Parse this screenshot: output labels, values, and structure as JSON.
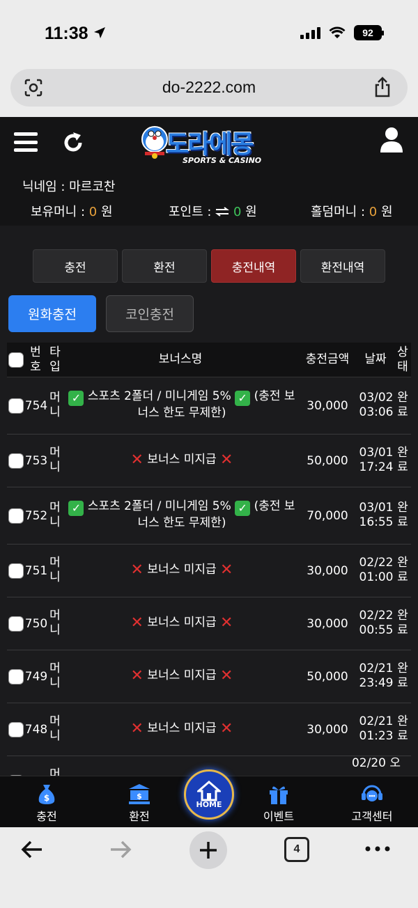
{
  "status_bar": {
    "time": "11:38",
    "battery": "92"
  },
  "browser": {
    "url": "do-2222.com",
    "tab_count": "4"
  },
  "site": {
    "logo_text": "도라에몽",
    "logo_sub": "SPORTS & CASINO",
    "nickname_label": "닉네임 : 마르코찬",
    "money_label": "보유머니 :",
    "money_value": "0",
    "money_unit": "원",
    "point_label": "포인트 :",
    "point_value": "0",
    "point_unit": "원",
    "holdem_label": "홀덤머니 :",
    "holdem_value": "0",
    "holdem_unit": "원"
  },
  "tabs": [
    {
      "label": "충전",
      "active": false
    },
    {
      "label": "환전",
      "active": false
    },
    {
      "label": "충전내역",
      "active": true
    },
    {
      "label": "환전내역",
      "active": false
    }
  ],
  "sub_tabs": {
    "won": "원화충전",
    "coin": "코인충전"
  },
  "table": {
    "headers": {
      "num": "번\n호",
      "type": "타\n입",
      "bonus": "보너스명",
      "amount": "충전금액",
      "date": "날짜",
      "status": "상\n태"
    },
    "rows": [
      {
        "num": "754",
        "type": "머\n니",
        "bonus_kind": "sports",
        "bonus": "스포츠 2폴더 / 미니게임 5%",
        "bonus_tail": "(충전 보",
        "bonus_line2": "너스 한도 무제한)",
        "amount": "30,000",
        "date": "03/02\n03:06",
        "status": "완\n료"
      },
      {
        "num": "753",
        "type": "머\n니",
        "bonus_kind": "none",
        "bonus": "보너스 미지급",
        "amount": "50,000",
        "date": "03/01\n17:24",
        "status": "완\n료"
      },
      {
        "num": "752",
        "type": "머\n니",
        "bonus_kind": "sports",
        "bonus": "스포츠 2폴더 / 미니게임 5%",
        "bonus_tail": "(충전 보",
        "bonus_line2": "너스 한도 무제한)",
        "amount": "70,000",
        "date": "03/01\n16:55",
        "status": "완\n료"
      },
      {
        "num": "751",
        "type": "머\n니",
        "bonus_kind": "none",
        "bonus": "보너스 미지급",
        "amount": "30,000",
        "date": "02/22\n01:00",
        "status": "완\n료"
      },
      {
        "num": "750",
        "type": "머\n니",
        "bonus_kind": "none",
        "bonus": "보너스 미지급",
        "amount": "30,000",
        "date": "02/22\n00:55",
        "status": "완\n료"
      },
      {
        "num": "749",
        "type": "머\n니",
        "bonus_kind": "none",
        "bonus": "보너스 미지급",
        "amount": "50,000",
        "date": "02/21\n23:49",
        "status": "완\n료"
      },
      {
        "num": "748",
        "type": "머\n니",
        "bonus_kind": "none",
        "bonus": "보너스 미지급",
        "amount": "30,000",
        "date": "02/21\n01:23",
        "status": "완\n료"
      },
      {
        "num": "",
        "type": "머",
        "bonus_kind": "partial",
        "bonus": "",
        "amount": "",
        "date": "02/20 오",
        "status": ""
      }
    ]
  },
  "bottom_nav": {
    "charge": "충전",
    "exchange": "환전",
    "home": "HOME",
    "event": "이벤트",
    "support": "고객센터"
  },
  "colors": {
    "accent_blue": "#2c7ef0",
    "active_tab": "#8f2424",
    "zero": "#e9a23b",
    "green": "#3ec35a",
    "x_red": "#e03030"
  }
}
